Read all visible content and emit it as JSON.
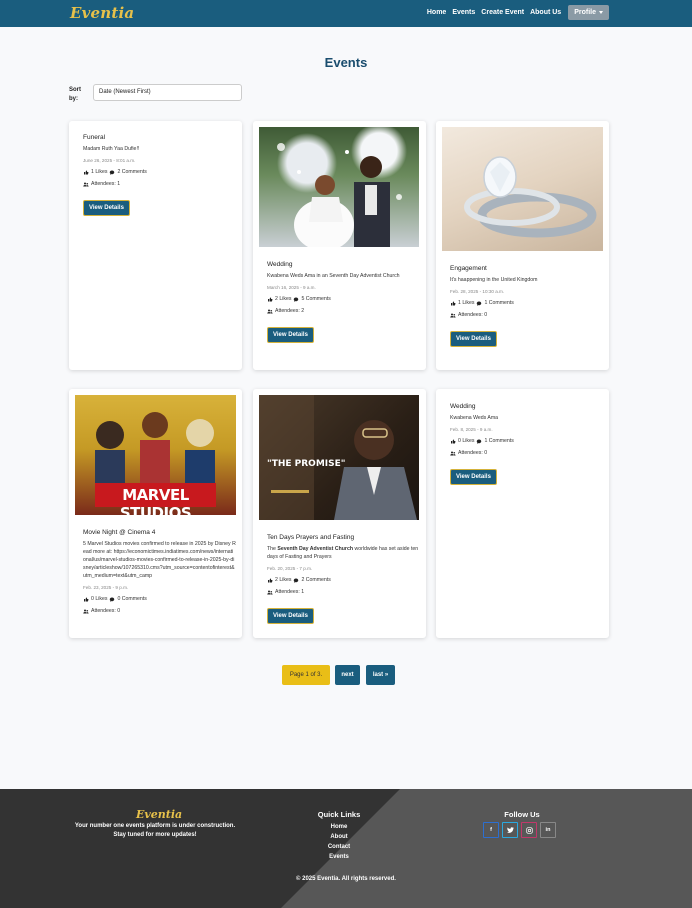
{
  "nav": {
    "brand": "Eventia",
    "links": [
      "Home",
      "Events",
      "Create Event",
      "About Us"
    ],
    "profile": "Profile"
  },
  "page_title": "Events",
  "sort": {
    "label": "Sort by:",
    "value": "Date (Newest First)"
  },
  "events": [
    {
      "title": "Funeral",
      "description": "Madam Ruth Yaa Dufie!!",
      "date": "June 26, 2025 - 8:01 a.m.",
      "likes": "1 Likes",
      "comments": "2 Comments",
      "attendees": "Attendees: 1",
      "button": "View Details",
      "image": "none"
    },
    {
      "title": "Wedding",
      "description": "Kwabena Weds Ama in an Seventh Day Adventist Church",
      "date": "March 16, 2025 - 9 a.m.",
      "likes": "2 Likes",
      "comments": "5 Comments",
      "attendees": "Attendees: 2",
      "button": "View Details",
      "image": "wedding-couple-photo"
    },
    {
      "title": "Engagement",
      "description": "It's haappening in the United Kingdom",
      "date": "Feb. 28, 2025 - 10:30 a.m.",
      "likes": "1 Likes",
      "comments": "1 Comments",
      "attendees": "Attendees: 0",
      "button": "View Details",
      "image": "engagement-ring-photo"
    },
    {
      "title": "Movie Night @ Cinema 4",
      "description": "5 Marvel Studios movies confirmed to release in 2025 by Disney Read more at: https://economictimes.indiatimes.com/news/international/us/marvel-studios-movies-confirmed-to-release-in-2025-by-disney/articleshow/107265310.cms?utm_source=contentofinterest&utm_medium=text&utm_camp",
      "date": "Feb. 23, 2025 - 9 p.m.",
      "likes": "0 Likes",
      "comments": "0 Comments",
      "attendees": "Attendees: 0",
      "button": "",
      "image": "marvel-studios-poster",
      "image_text": "MARVEL STUDIOS"
    },
    {
      "title": "Ten Days Prayers and Fasting",
      "description_pre": "The ",
      "description_bold": "Seventh Day Adventist Church",
      "description_post": " worldwide has set aside ten days of Fasting and Prayers",
      "date": "Feb. 20, 2025 - 7 p.m.",
      "likes": "2 Likes",
      "comments": "2 Comments",
      "attendees": "Attendees: 1",
      "button": "View Details",
      "image": "the-promise-poster",
      "image_text": "\"THE PROMISE\""
    },
    {
      "title": "Wedding",
      "description": "Kwabena Weds Ama",
      "date": "Feb. 8, 2025 - 9 a.m.",
      "likes": "0 Likes",
      "comments": "1 Comments",
      "attendees": "Attendees: 0",
      "button": "View Details",
      "image": "none"
    }
  ],
  "pagination": {
    "info": "Page 1 of 3.",
    "next": "next",
    "last": "last »"
  },
  "footer": {
    "brand": "Eventia",
    "tagline_1": "Your number one events platform is under construction.",
    "tagline_2": "Stay tuned for more updates!",
    "quick_links_title": "Quick Links",
    "quick_links": [
      "Home",
      "About",
      "Contact",
      "Events"
    ],
    "follow_title": "Follow Us",
    "socials": [
      "f",
      "t",
      "ig",
      "in"
    ],
    "copyright": "© 2025 Eventia. All rights reserved."
  },
  "colors": {
    "navbar": "#1a5d7e",
    "accent_gold": "#e7c14a",
    "title_blue": "#1a4d6e",
    "page_info": "#e9be17"
  }
}
